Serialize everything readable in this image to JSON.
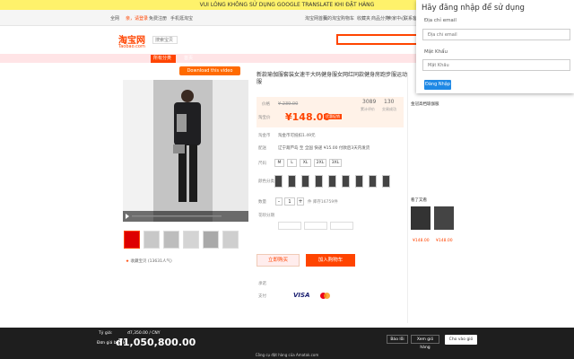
{
  "notice": "VUI LÒNG KHÔNG SỬ DỤNG GOOGLE TRANSLATE KHI ĐẶT HÀNG",
  "topbar": {
    "left": [
      "全网",
      "亲，请登录",
      "免费注册",
      "手机逛淘宝"
    ],
    "right": [
      "淘宝网首页",
      "我的淘宝",
      "购物车",
      "收藏夹",
      "商品分类",
      "卖家中心",
      "联系客服",
      "网站导航"
    ]
  },
  "logo": {
    "main": "淘宝网",
    "sub": "Taobao.com",
    "shop_select": "搜索宝贝"
  },
  "nav": {
    "category": "所有分类",
    "home": "首页"
  },
  "download_video": "Download this video",
  "product": {
    "title": "新款瑜伽服套装女速干大码健身服女网红同款健身房跑步服运动服",
    "original_price_label": "价格",
    "original_price": "¥ 239.00",
    "price_label": "淘宝价",
    "price": "¥148.00",
    "price_tag": "优惠促销",
    "stats": [
      {
        "num": "3089",
        "label": "累计评价"
      },
      {
        "num": "130",
        "label": "交易成功"
      }
    ],
    "promo_label": "淘金币",
    "promo_text": "淘金币可抵扣1.49元",
    "shipping_label": "配送",
    "shipping_text": "辽宁葫芦岛 至 全国 快递 ¥15.00 付款后3天内发货",
    "size_label": "尺码",
    "sizes": [
      "M",
      "L",
      "XL",
      "2XL",
      "3XL"
    ],
    "color_label": "颜色分类",
    "quantity_label": "数量",
    "quantity": "1",
    "stock_text": "件 库存16759件",
    "service_label": "花呗分期",
    "buy_now": "立即购买",
    "add_cart": "加入购物车",
    "promise_label": "承诺",
    "payment_label": "支付",
    "payment_visa": "VISA",
    "favorite": "收藏宝贝 (13631人气)"
  },
  "login": {
    "title": "Hãy đăng nhập để sử dụng",
    "email_label": "Địa chỉ email",
    "email_placeholder": "Địa chỉ email",
    "password_label": "Mật Khẩu",
    "password_placeholder": "Mật Khẩu",
    "button": "Đăng Nhập"
  },
  "right_panel": {
    "seller": "金冠高档瑜伽服",
    "see_also": "看了又看",
    "prices": [
      "¥148.00",
      "¥148.00"
    ]
  },
  "bottom": {
    "rate_label": "Tỷ giá:",
    "rate_value": "đ7,350.00 / CNY",
    "price_label": "Đơn giá bán lẻ:",
    "price_vnd": "đ1,050,800.00",
    "warn_button": "Báo lỗi",
    "cart_button": "Xem giỏ hàng",
    "add_button": "Cho vào giỏ",
    "footer": "Công cụ đặt hàng của Amatak.com"
  },
  "colors": {
    "brand": "#ff4400",
    "login_button": "#1e88e5",
    "notice_bg": "#fef26b"
  }
}
